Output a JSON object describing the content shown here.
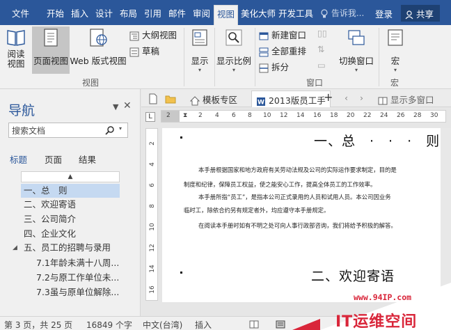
{
  "ribbon_tabs": [
    "文件",
    "开始",
    "插入",
    "设计",
    "布局",
    "引用",
    "邮件",
    "审阅",
    "视图",
    "美化大师",
    "开发工具"
  ],
  "active_tab": "视图",
  "tell_me": "告诉我...",
  "login": "登录",
  "share": "共享",
  "ribbon": {
    "read_view": "阅读\n视图",
    "read_view_l1": "阅读",
    "read_view_l2": "视图",
    "page_view": "页面视图",
    "web_view": "Web 版式视图",
    "outline_view": "大纲视图",
    "draft": "草稿",
    "group_view": "视图",
    "show": "显示",
    "zoom": "显示比例",
    "new_window": "新建窗口",
    "arrange_all": "全部重排",
    "split": "拆分",
    "switch_window": "切换窗口",
    "group_window": "窗口",
    "macro": "宏",
    "group_macro": "宏"
  },
  "nav": {
    "title": "导航",
    "search_placeholder": "搜索文档",
    "tabs": [
      "标题",
      "页面",
      "结果"
    ],
    "headings": [
      "一、总　则",
      "二、欢迎寄语",
      "三、公司简介",
      "四、企业文化",
      "五、员工的招聘与录用",
      "7.1年龄未满十八周...",
      "7.2与原工作单位未...",
      "7.3虽与原单位解除..."
    ]
  },
  "doc_tabs": {
    "template": "模板专区",
    "active_doc": "2013版员工手",
    "show_windows": "显示多窗口"
  },
  "ruler_marks": [
    "2",
    "2",
    "4",
    "6",
    "8",
    "10",
    "12",
    "14",
    "16",
    "18",
    "20",
    "22",
    "24",
    "26",
    "28",
    "30"
  ],
  "vruler_marks": [
    "2",
    "4",
    "6",
    "8",
    "10",
    "12",
    "14",
    "16"
  ],
  "document": {
    "heading1": "一、总　·　·　·　则",
    "para1a": "本手册根据国家和地方政府有关劳动法规及公司的实际运作要求制定，目的是",
    "para1b": "制度和纪律，保障员工权益，使之能安心工作，提高全体员工的工作效率。",
    "para2a": "本手册所指“员工”，是指本公司正式录用的人员和试用人员。本公司因业务",
    "para2b": "临时工，除依合约另有规定者外，均应遵守本手册规定。",
    "para3": "在阅读本手册时如有不明之处可向人事行政部咨询，我们将给予积极的解答。",
    "heading2": "二、欢迎寄语"
  },
  "status": {
    "page": "第 3 页，共 25 页",
    "words": "16849 个字",
    "language": "中文(台湾)",
    "mode": "插入"
  },
  "watermark": {
    "url": "www.94IP.com",
    "text": "IT运维空间"
  },
  "colors": {
    "brand": "#2b579a",
    "selected_heading": "#c5d9f1",
    "watermark": "#d9263a"
  }
}
